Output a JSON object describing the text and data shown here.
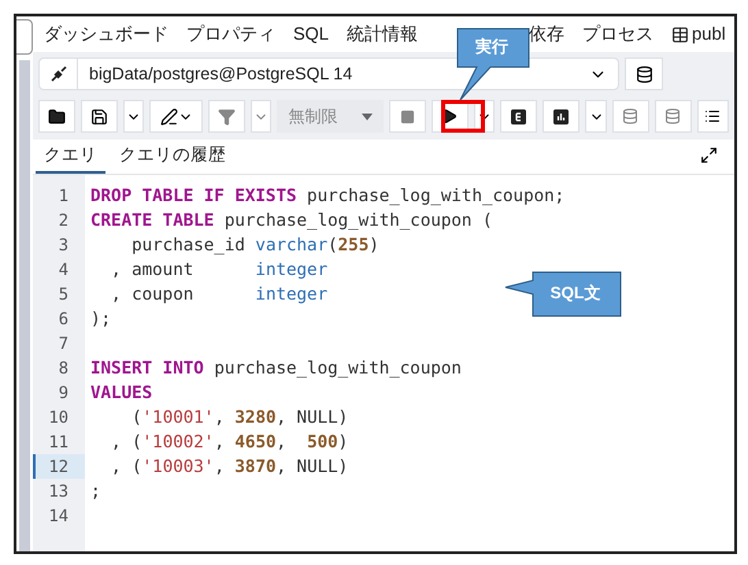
{
  "top_tabs": [
    {
      "label": "ダッシュボード"
    },
    {
      "label": "プロパティ"
    },
    {
      "label": "SQL"
    },
    {
      "label": "統計情報"
    },
    {
      "label": "依存"
    },
    {
      "label": "プロセス"
    },
    {
      "label": "publ",
      "kind": "table"
    }
  ],
  "connection": {
    "value": "bigData/postgres@PostgreSQL 14"
  },
  "toolbar": {
    "limit": "無制限"
  },
  "editor_tabs": [
    {
      "label": "クエリ",
      "selected": true
    },
    {
      "label": "クエリの履歴",
      "selected": false
    }
  ],
  "code_lines": [
    {
      "number": "1",
      "tokens": [
        {
          "kind": "keyword",
          "text": "DROP TABLE IF EXISTS"
        },
        {
          "kind": "plain",
          "text": " purchase_log_with_coupon;"
        }
      ]
    },
    {
      "number": "2",
      "tokens": [
        {
          "kind": "keyword",
          "text": "CREATE TABLE"
        },
        {
          "kind": "plain",
          "text": " purchase_log_with_coupon ("
        }
      ]
    },
    {
      "number": "3",
      "tokens": [
        {
          "kind": "plain",
          "text": "    purchase_id "
        },
        {
          "kind": "type",
          "text": "varchar"
        },
        {
          "kind": "plain",
          "text": "("
        },
        {
          "kind": "number",
          "text": "255"
        },
        {
          "kind": "plain",
          "text": ")"
        }
      ]
    },
    {
      "number": "4",
      "tokens": [
        {
          "kind": "plain",
          "text": "  , amount      "
        },
        {
          "kind": "type",
          "text": "integer"
        }
      ]
    },
    {
      "number": "5",
      "tokens": [
        {
          "kind": "plain",
          "text": "  , coupon      "
        },
        {
          "kind": "type",
          "text": "integer"
        }
      ]
    },
    {
      "number": "6",
      "tokens": [
        {
          "kind": "plain",
          "text": ");"
        }
      ]
    },
    {
      "number": "7"
    },
    {
      "number": "8",
      "tokens": [
        {
          "kind": "keyword",
          "text": "INSERT INTO"
        },
        {
          "kind": "plain",
          "text": " purchase_log_with_coupon"
        }
      ]
    },
    {
      "number": "9",
      "tokens": [
        {
          "kind": "keyword",
          "text": "VALUES"
        }
      ]
    },
    {
      "number": "10",
      "tokens": [
        {
          "kind": "plain",
          "text": "    ("
        },
        {
          "kind": "string",
          "text": "'10001'"
        },
        {
          "kind": "plain",
          "text": ", "
        },
        {
          "kind": "number",
          "text": "3280"
        },
        {
          "kind": "plain",
          "text": ", NULL)"
        }
      ]
    },
    {
      "number": "11",
      "tokens": [
        {
          "kind": "plain",
          "text": "  , ("
        },
        {
          "kind": "string",
          "text": "'10002'"
        },
        {
          "kind": "plain",
          "text": ", "
        },
        {
          "kind": "number",
          "text": "4650"
        },
        {
          "kind": "plain",
          "text": ",  "
        },
        {
          "kind": "number",
          "text": "500"
        },
        {
          "kind": "plain",
          "text": ")"
        }
      ]
    },
    {
      "number": "12",
      "marked": true,
      "tokens": [
        {
          "kind": "plain",
          "text": "  , ("
        },
        {
          "kind": "string",
          "text": "'10003'"
        },
        {
          "kind": "plain",
          "text": ", "
        },
        {
          "kind": "number",
          "text": "3870"
        },
        {
          "kind": "plain",
          "text": ", NULL)"
        }
      ]
    },
    {
      "number": "13",
      "tokens": [
        {
          "kind": "plain",
          "text": ";"
        }
      ]
    },
    {
      "number": "14"
    }
  ],
  "callouts": [
    {
      "text": "実行"
    },
    {
      "text": "SQL文"
    }
  ]
}
